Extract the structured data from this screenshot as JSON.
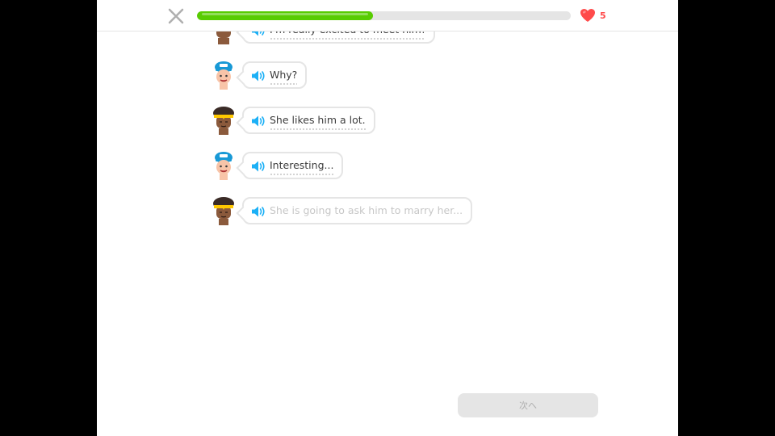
{
  "header": {
    "progress": 0.47,
    "hearts": "5",
    "close_icon": "close-x-icon",
    "heart_icon": "heart-icon"
  },
  "conversation": [
    {
      "speaker": "woman",
      "text": "I'm really excited to meet him!",
      "state": "read"
    },
    {
      "speaker": "man",
      "text": "Why?",
      "state": "read"
    },
    {
      "speaker": "woman",
      "text": "She likes him a lot.",
      "state": "read"
    },
    {
      "speaker": "man",
      "text": "Interesting...",
      "state": "read"
    },
    {
      "speaker": "woman",
      "text": "She is going to ask him to marry her...",
      "state": "pending"
    }
  ],
  "footer": {
    "continue_label": "次へ"
  },
  "colors": {
    "progress_green": "#58cc02",
    "heart_red": "#ff4b4b",
    "speaker_blue": "#1cb0f6",
    "disabled_button": "#e5e5e5"
  }
}
